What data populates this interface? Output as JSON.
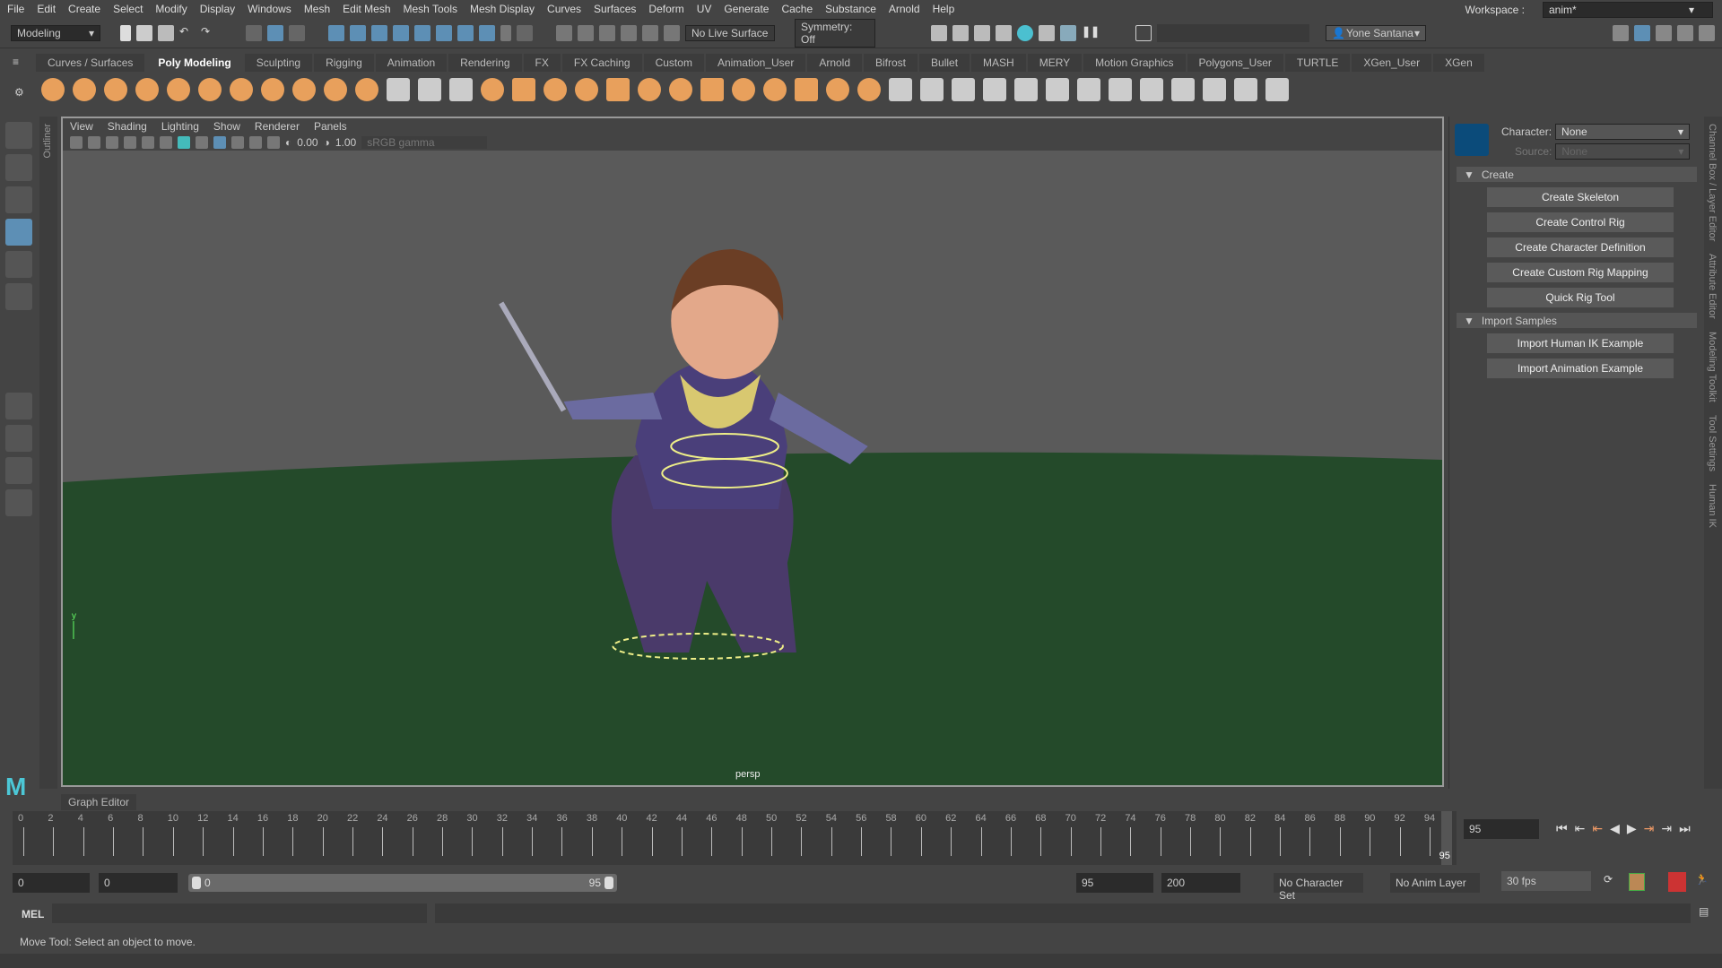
{
  "menubar": {
    "items": [
      "File",
      "Edit",
      "Create",
      "Select",
      "Modify",
      "Display",
      "Windows",
      "Mesh",
      "Edit Mesh",
      "Mesh Tools",
      "Mesh Display",
      "Curves",
      "Surfaces",
      "Deform",
      "UV",
      "Generate",
      "Cache",
      "Substance",
      "Arnold",
      "Help"
    ],
    "workspace_label": "Workspace :",
    "workspace_value": "anim*"
  },
  "status": {
    "mode": "Modeling",
    "live_surface": "No Live Surface",
    "symmetry": "Symmetry: Off",
    "user": "Yone Santana"
  },
  "shelf": {
    "tabs": [
      "Curves / Surfaces",
      "Poly Modeling",
      "Sculpting",
      "Rigging",
      "Animation",
      "Rendering",
      "FX",
      "FX Caching",
      "Custom",
      "Animation_User",
      "Arnold",
      "Bifrost",
      "Bullet",
      "MASH",
      "MERY",
      "Motion Graphics",
      "Polygons_User",
      "TURTLE",
      "XGen_User",
      "XGen"
    ],
    "active": "Poly Modeling",
    "icons": [
      "poly-sphere-icon",
      "poly-cube-icon",
      "poly-cylinder-icon",
      "poly-cone-icon",
      "poly-torus-icon",
      "poly-plane-icon",
      "poly-disc-icon",
      "platonic-icon",
      "sweep-icon",
      "type-icon",
      "svg-icon",
      "measure-icon",
      "center-pivot-icon",
      "freeze-transform-icon",
      "combine-icon",
      "separate-icon",
      "mirror-icon",
      "smooth-icon",
      "extrude-icon",
      "bridge-icon",
      "bevel-icon",
      "fill-hole-icon",
      "boolean-icon",
      "multi-cut-icon",
      "target-weld-icon",
      "bevel2-icon",
      "merge-icon",
      "uv-icon",
      "quad-draw-icon",
      "offset-edge-icon",
      "insert-loop-icon",
      "bridge2-icon",
      "append-icon",
      "slide-icon",
      "triangulate-icon",
      "quadrangulate-icon",
      "reduce-icon",
      "cleanup-icon",
      "connect-icon",
      "collapse-icon"
    ]
  },
  "viewport": {
    "menu": [
      "View",
      "Shading",
      "Lighting",
      "Show",
      "Renderer",
      "Panels"
    ],
    "exposure": "0.00",
    "gamma": "1.00",
    "color_space": "sRGB gamma",
    "camera": "persp",
    "axis_y": "y"
  },
  "outliner": {
    "label": "Outliner"
  },
  "hik": {
    "character_label": "Character:",
    "character_value": "None",
    "source_label": "Source:",
    "source_value": "None",
    "create_section": "Create",
    "create_buttons": [
      "Create Skeleton",
      "Create Control Rig",
      "Create Character Definition",
      "Create Custom Rig Mapping",
      "Quick Rig Tool"
    ],
    "import_section": "Import Samples",
    "import_buttons": [
      "Import Human IK Example",
      "Import Animation Example"
    ]
  },
  "right_tabs": [
    "Channel Box / Layer Editor",
    "Attribute Editor",
    "Modeling Toolkit",
    "Tool Settings",
    "Human IK"
  ],
  "graph_editor_tab": "Graph Editor",
  "timeline": {
    "ticks": [
      "0",
      "2",
      "4",
      "6",
      "8",
      "10",
      "12",
      "14",
      "16",
      "18",
      "20",
      "22",
      "24",
      "26",
      "28",
      "30",
      "32",
      "34",
      "36",
      "38",
      "40",
      "42",
      "44",
      "46",
      "48",
      "50",
      "52",
      "54",
      "56",
      "58",
      "60",
      "62",
      "64",
      "66",
      "68",
      "70",
      "72",
      "74",
      "76",
      "78",
      "80",
      "82",
      "84",
      "86",
      "88",
      "90",
      "92",
      "94"
    ],
    "current_frame": "95",
    "current_field": "95"
  },
  "range": {
    "start": "0",
    "anim_start": "0",
    "slider_start": "0",
    "slider_end": "95",
    "end": "95",
    "anim_end": "200",
    "character_set": "No Character Set",
    "anim_layer": "No Anim Layer",
    "fps": "30 fps"
  },
  "mel": {
    "label": "MEL"
  },
  "help": {
    "text": "Move Tool: Select an object to move."
  },
  "colors": {
    "accent": "#5d8fb5",
    "ground": "#244a2a",
    "sky": "#5a5a5a",
    "shelf_icon": "#e8a05c"
  }
}
